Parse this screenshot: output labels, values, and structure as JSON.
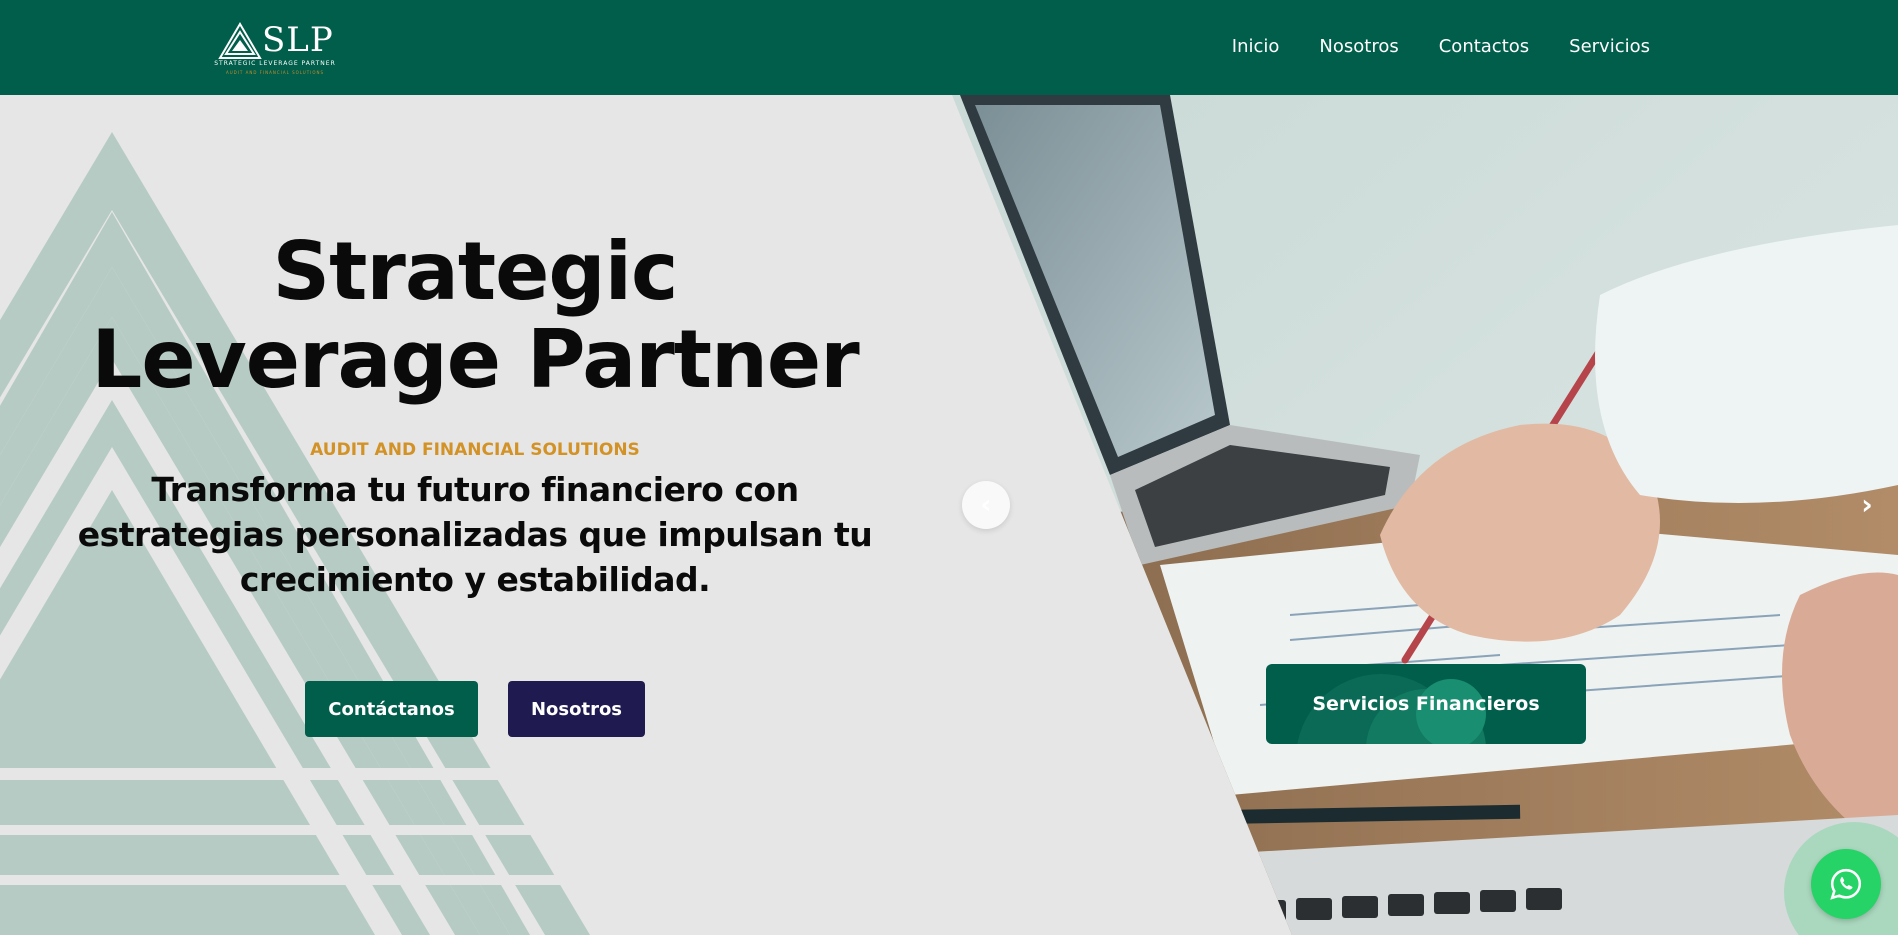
{
  "brand": {
    "logo_text": "SLP",
    "logo_subtitle": "STRATEGIC LEVERAGE PARTNER",
    "logo_tagline": "AUDIT AND FINANCIAL SOLUTIONS"
  },
  "nav": {
    "items": [
      {
        "label": "Inicio"
      },
      {
        "label": "Nosotros"
      },
      {
        "label": "Contactos"
      },
      {
        "label": "Servicios"
      }
    ]
  },
  "hero": {
    "title_line1": "Strategic",
    "title_line2": "Leverage Partner",
    "subtitle": "AUDIT AND FINANCIAL SOLUTIONS",
    "description": "Transforma tu futuro financiero con estrategias personalizadas que impulsan tu crecimiento y estabilidad.",
    "buttons": {
      "contact": "Contáctanos",
      "about": "Nosotros"
    },
    "service_card": "Servicios Financieros",
    "carousel": {
      "prev_icon": "chevron-left-icon",
      "next_icon": "chevron-right-icon"
    }
  },
  "floating": {
    "whatsapp_icon": "whatsapp-icon"
  },
  "colors": {
    "primary": "#005e4b",
    "accent": "#d39226",
    "secondary_button": "#1f1a4f",
    "whatsapp": "#25d366",
    "hero_bg": "#e6e6e6",
    "triangle": "#b7cbc5"
  }
}
